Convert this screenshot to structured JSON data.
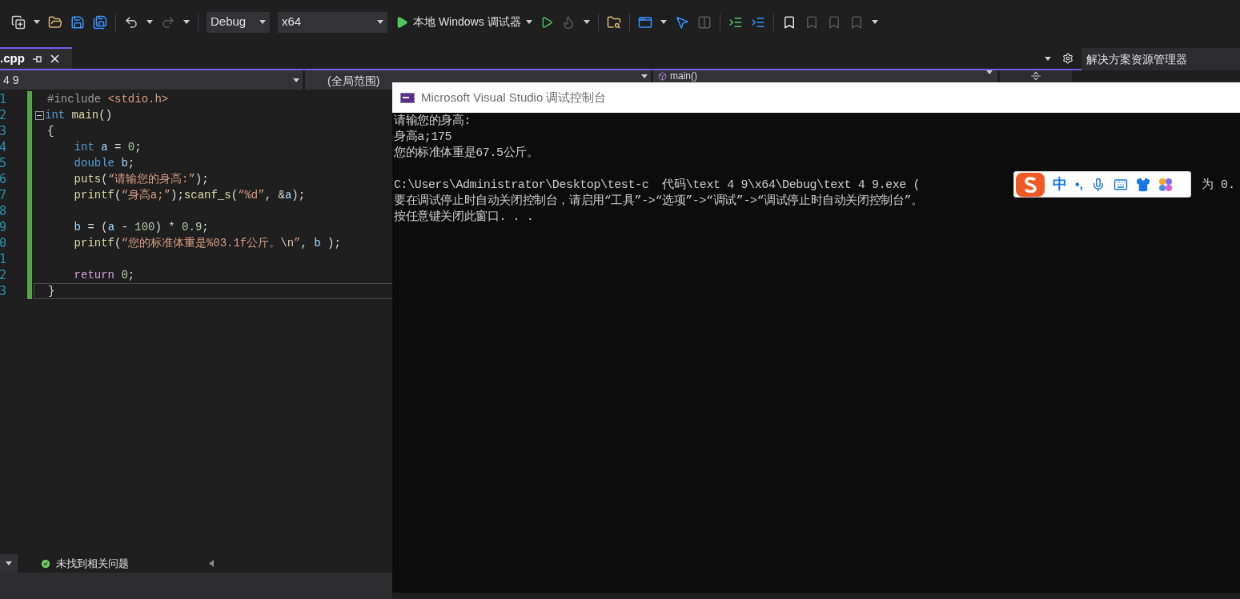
{
  "toolbar": {
    "configuration": "Debug",
    "platform": "x64",
    "debugger": "本地 Windows 调试器"
  },
  "document_tab": {
    "title": ".cpp",
    "selected": true
  },
  "navigation_bar": {
    "project": "4 9",
    "scope": "(全局范围)",
    "member": "main()"
  },
  "solution_explorer": {
    "title": "解决方案资源管理器"
  },
  "editor": {
    "lines": [
      {
        "number": "1",
        "foldable": false,
        "tokens": [
          {
            "kind": "pre",
            "text": "#include "
          },
          {
            "kind": "str",
            "text": "<stdio.h>"
          }
        ]
      },
      {
        "number": "2",
        "foldable": true,
        "tokens": [
          {
            "kind": "kw",
            "text": "int"
          },
          {
            "kind": "fn",
            "text": " main"
          },
          {
            "kind": "p",
            "text": "()"
          }
        ]
      },
      {
        "number": "3",
        "foldable": false,
        "tokens": [
          {
            "kind": "p",
            "text": "{"
          }
        ]
      },
      {
        "number": "4",
        "foldable": false,
        "tokens": [
          {
            "kind": "kw",
            "text": "    int"
          },
          {
            "kind": "var",
            "text": " a"
          },
          {
            "kind": "p",
            "text": " = "
          },
          {
            "kind": "num",
            "text": "0"
          },
          {
            "kind": "p",
            "text": ";"
          }
        ]
      },
      {
        "number": "5",
        "foldable": false,
        "tokens": [
          {
            "kind": "kw",
            "text": "    double"
          },
          {
            "kind": "var",
            "text": " b"
          },
          {
            "kind": "p",
            "text": ";"
          }
        ]
      },
      {
        "number": "6",
        "foldable": false,
        "tokens": [
          {
            "kind": "fn",
            "text": "    puts"
          },
          {
            "kind": "p",
            "text": "("
          },
          {
            "kind": "str",
            "text": "“请输您的身高:”"
          },
          {
            "kind": "p",
            "text": ");"
          }
        ]
      },
      {
        "number": "7",
        "foldable": false,
        "tokens": [
          {
            "kind": "fn",
            "text": "    printf"
          },
          {
            "kind": "p",
            "text": "("
          },
          {
            "kind": "str",
            "text": "“身高a;”"
          },
          {
            "kind": "p",
            "text": ");"
          },
          {
            "kind": "fn",
            "text": "scanf_s"
          },
          {
            "kind": "p",
            "text": "("
          },
          {
            "kind": "str",
            "text": "“%d”"
          },
          {
            "kind": "p",
            "text": ", &"
          },
          {
            "kind": "var",
            "text": "a"
          },
          {
            "kind": "p",
            "text": ");"
          }
        ]
      },
      {
        "number": "8",
        "foldable": false
      },
      {
        "number": "9",
        "foldable": false,
        "tokens": [
          {
            "kind": "var",
            "text": "    b"
          },
          {
            "kind": "p",
            "text": " = ("
          },
          {
            "kind": "var",
            "text": "a"
          },
          {
            "kind": "p",
            "text": " - "
          },
          {
            "kind": "num",
            "text": "100"
          },
          {
            "kind": "p",
            "text": ") * "
          },
          {
            "kind": "num",
            "text": "0.9"
          },
          {
            "kind": "p",
            "text": ";"
          }
        ]
      },
      {
        "number": "0",
        "foldable": false,
        "tokens": [
          {
            "kind": "fn",
            "text": "    printf"
          },
          {
            "kind": "p",
            "text": "("
          },
          {
            "kind": "str",
            "text": "“您的标准体重是%03.1f公斤。"
          },
          {
            "kind": "esc",
            "text": "\\n"
          },
          {
            "kind": "str",
            "text": "”"
          },
          {
            "kind": "p",
            "text": ", "
          },
          {
            "kind": "var",
            "text": "b"
          },
          {
            "kind": "p",
            "text": " );"
          }
        ]
      },
      {
        "number": "1",
        "foldable": false
      },
      {
        "number": "2",
        "foldable": false,
        "tokens": [
          {
            "kind": "ret",
            "text": "    return"
          },
          {
            "kind": "num",
            "text": " 0"
          },
          {
            "kind": "p",
            "text": ";"
          }
        ]
      },
      {
        "number": "3",
        "foldable": false,
        "tokens": [
          {
            "kind": "p",
            "text": "}"
          }
        ]
      }
    ]
  },
  "error_status": "未找到相关问题",
  "console": {
    "title": "Microsoft Visual Studio 调试控制台",
    "lines": [
      {
        "text": "请输您的身高:",
        "blank_before": false
      },
      {
        "text": "身高a;175",
        "blank_before": false
      },
      {
        "text": "您的标准体重是67.5公斤。",
        "blank_before": false
      },
      {
        "text": "C:\\Users\\Administrator\\Desktop\\test-c  代码\\text 4 9\\x64\\Debug\\text 4 9.exe (",
        "after_overlay": "为 0.",
        "blank_before": true
      },
      {
        "text": "要在调试停止时自动关闭控制台，请启用“工具”->“选项”->“调试”->“调试停止时自动关闭控制台”。",
        "blank_before": false
      },
      {
        "text": "按任意键关闭此窗口. . .",
        "blank_before": false
      }
    ]
  },
  "ime_toolbar": {
    "mode": "中",
    "punctuation": "•,"
  }
}
